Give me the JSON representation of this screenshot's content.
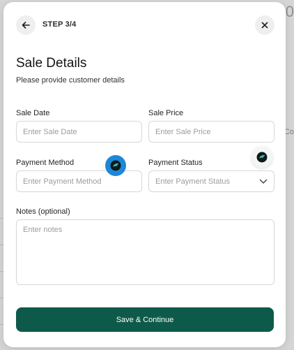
{
  "background": {
    "fragment_top_right": "0",
    "fragment_right_1": "Co"
  },
  "header": {
    "step_label": "STEP 3/4",
    "back_icon": "arrow-left-icon",
    "close_icon": "close-icon"
  },
  "form": {
    "title": "Sale Details",
    "subtitle": "Please provide customer details",
    "sale_date": {
      "label": "Sale Date",
      "placeholder": "Enter Sale Date"
    },
    "sale_price": {
      "label": "Sale Price",
      "placeholder": "Enter Sale Price"
    },
    "payment_method": {
      "label": "Payment Method",
      "placeholder": "Enter Payment Method"
    },
    "payment_status": {
      "label": "Payment Status",
      "placeholder": "Enter Payment Status"
    },
    "notes": {
      "label": "Notes (optional)",
      "placeholder": "Enter notes"
    },
    "save_label": "Save & Continue"
  },
  "colors": {
    "primary": "#0e5a4a",
    "accent_badge": "#1e88d8"
  }
}
